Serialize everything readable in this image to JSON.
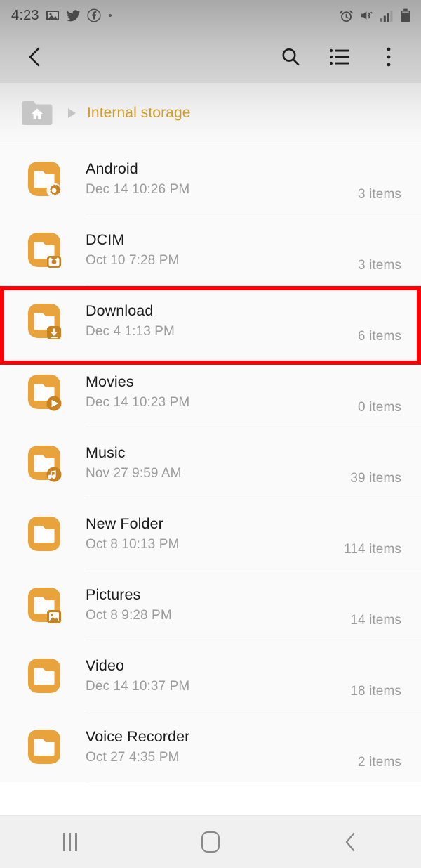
{
  "status_bar": {
    "clock": "4:23",
    "left_icons": [
      "image-icon",
      "twitter-icon",
      "facebook-icon",
      "dot-icon"
    ],
    "right_icons": [
      "alarm-icon",
      "mute-vibrate-icon",
      "signal-icon",
      "battery-icon"
    ]
  },
  "toolbar": {
    "back_icon": "back-chevron-icon",
    "search_icon": "search-icon",
    "list_view_icon": "list-view-icon",
    "more_icon": "more-vertical-icon"
  },
  "breadcrumb": {
    "home_icon": "home-folder-icon",
    "separator_icon": "triangle-right-icon",
    "current": "Internal storage",
    "accent_color": "#d19b28"
  },
  "files": [
    {
      "name": "Android",
      "date": "Dec 14 10:26 PM",
      "count": "3 items",
      "badge": "gear-badge-icon"
    },
    {
      "name": "DCIM",
      "date": "Oct 10 7:28 PM",
      "count": "3 items",
      "badge": "camera-badge-icon"
    },
    {
      "name": "Download",
      "date": "Dec 4 1:13 PM",
      "count": "6 items",
      "badge": "download-badge-icon"
    },
    {
      "name": "Movies",
      "date": "Dec 14 10:23 PM",
      "count": "0 items",
      "badge": "play-badge-icon"
    },
    {
      "name": "Music",
      "date": "Nov 27 9:59 AM",
      "count": "39 items",
      "badge": "music-note-badge-icon"
    },
    {
      "name": "New Folder",
      "date": "Oct 8 10:13 PM",
      "count": "114 items",
      "badge": "none"
    },
    {
      "name": "Pictures",
      "date": "Oct 8 9:28 PM",
      "count": "14 items",
      "badge": "image-badge-icon"
    },
    {
      "name": "Video",
      "date": "Dec 14 10:37 PM",
      "count": "18 items",
      "badge": "none"
    },
    {
      "name": "Voice Recorder",
      "date": "Oct 27 4:35 PM",
      "count": "2 items",
      "badge": "none"
    }
  ],
  "annotation": {
    "type": "red-rectangle-highlight",
    "target_row": "Download",
    "color": "#fb0007"
  },
  "nav_bar": {
    "recents_icon": "recents-icon",
    "home_icon": "home-icon",
    "back_icon": "nav-back-icon"
  },
  "theme": {
    "folder_orange": "#e8a33d",
    "folder_orange_dark": "#c8821f",
    "text_primary": "#1b1b1b",
    "text_secondary": "#9b9b9b",
    "list_background": "#fafafa"
  }
}
